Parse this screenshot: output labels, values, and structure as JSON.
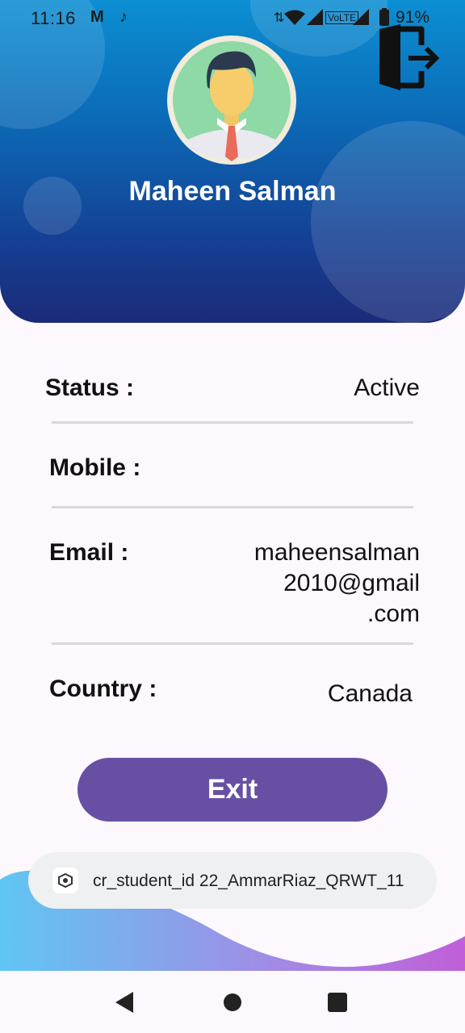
{
  "status_bar": {
    "time": "11:16",
    "battery": "91%",
    "icons": [
      "gmail-icon",
      "tiktok-icon",
      "data-arrows-icon",
      "wifi-icon",
      "signal-icon",
      "volte-icon",
      "signal-icon",
      "battery-icon"
    ]
  },
  "header": {
    "user_name": "Maheen Salman",
    "logout_icon": "logout-door-icon",
    "avatar_icon": "user-avatar-icon"
  },
  "details": {
    "status_label": "Status :",
    "status_value": "Active",
    "mobile_label": "Mobile :",
    "mobile_value": "",
    "email_label": "Email :",
    "email_lines": [
      "maheensalman",
      "2010@gmail",
      ".com"
    ],
    "country_label": "Country :",
    "country_value": "Canada"
  },
  "exit_button_label": "Exit",
  "toast": {
    "text": "cr_student_id 22_AmmarRiaz_QRWT_11",
    "icon": "app-icon"
  },
  "nav_bar": {
    "icons": [
      "back-icon",
      "home-icon",
      "recents-icon"
    ]
  },
  "colors": {
    "header_top": "#0c8fd3",
    "header_bottom": "#1b2a78",
    "exit_button": "#6750a4",
    "background": "#fcf8fd"
  }
}
